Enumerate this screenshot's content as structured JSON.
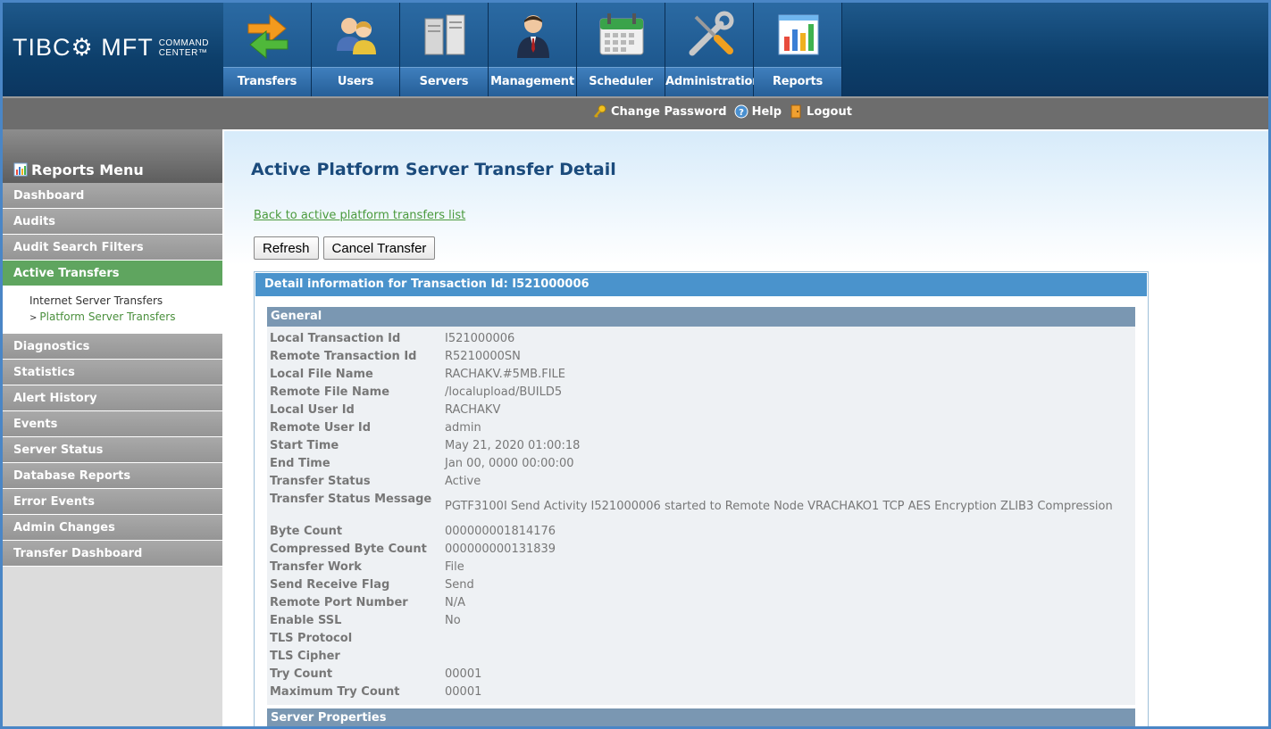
{
  "app": {
    "logo_brand": "TIBC⚙ MFT",
    "logo_sub_line1": "COMMAND",
    "logo_sub_line2": "CENTER™"
  },
  "nav": {
    "items": [
      {
        "label": "Transfers",
        "icon": "transfers-arrows-icon"
      },
      {
        "label": "Users",
        "icon": "users-icon"
      },
      {
        "label": "Servers",
        "icon": "servers-icon"
      },
      {
        "label": "Management",
        "icon": "manager-person-icon"
      },
      {
        "label": "Scheduler",
        "icon": "calendar-icon"
      },
      {
        "label": "Administration",
        "icon": "tools-wrench-screwdriver-icon"
      },
      {
        "label": "Reports",
        "icon": "bar-chart-icon"
      }
    ]
  },
  "toolbar": {
    "change_password": "Change Password",
    "help": "Help",
    "logout": "Logout"
  },
  "sidebar": {
    "title": "Reports Menu",
    "items": [
      {
        "label": "Dashboard"
      },
      {
        "label": "Audits"
      },
      {
        "label": "Audit Search Filters"
      },
      {
        "label": "Active Transfers"
      },
      {
        "label": "Diagnostics"
      },
      {
        "label": "Statistics"
      },
      {
        "label": "Alert History"
      },
      {
        "label": "Events"
      },
      {
        "label": "Server Status"
      },
      {
        "label": "Database Reports"
      },
      {
        "label": "Error Events"
      },
      {
        "label": "Admin Changes"
      },
      {
        "label": "Transfer Dashboard"
      }
    ],
    "submenu": [
      {
        "label": "Internet Server Transfers"
      },
      {
        "label": "Platform Server Transfers",
        "marker": ">"
      }
    ]
  },
  "main": {
    "title": "Active Platform Server Transfer Detail",
    "back_link": "Back to active platform transfers list",
    "refresh_button": "Refresh",
    "cancel_button": "Cancel Transfer",
    "panel_title": "Detail information for Transaction Id: I521000006",
    "general_title": "General",
    "server_properties_title": "Server Properties",
    "fields": [
      {
        "k": "Local Transaction Id",
        "v": "I521000006"
      },
      {
        "k": "Remote Transaction Id",
        "v": "R5210000SN"
      },
      {
        "k": "Local File Name",
        "v": "RACHAKV.#5MB.FILE"
      },
      {
        "k": "Remote File Name",
        "v": "/localupload/BUILD5"
      },
      {
        "k": "Local User Id",
        "v": "RACHAKV"
      },
      {
        "k": "Remote User Id",
        "v": "admin"
      },
      {
        "k": "Start Time",
        "v": "May 21, 2020 01:00:18"
      },
      {
        "k": "End Time",
        "v": "Jan 00, 0000 00:00:00"
      },
      {
        "k": "Transfer Status",
        "v": "Active"
      },
      {
        "k": "Transfer Status Message",
        "v": "PGTF3100I Send Activity I521000006 started to Remote Node VRACHAKO1 TCP AES Encryption ZLIB3 Compression"
      },
      {
        "k": "Byte Count",
        "v": "000000001814176"
      },
      {
        "k": "Compressed Byte Count",
        "v": "000000000131839"
      },
      {
        "k": "Transfer Work",
        "v": "File"
      },
      {
        "k": "Send Receive Flag",
        "v": "Send"
      },
      {
        "k": "Remote Port Number",
        "v": "N/A"
      },
      {
        "k": "Enable SSL",
        "v": "No"
      },
      {
        "k": "TLS Protocol",
        "v": ""
      },
      {
        "k": "TLS Cipher",
        "v": ""
      },
      {
        "k": "Try Count",
        "v": "00001"
      },
      {
        "k": "Maximum Try Count",
        "v": "00001"
      }
    ]
  }
}
